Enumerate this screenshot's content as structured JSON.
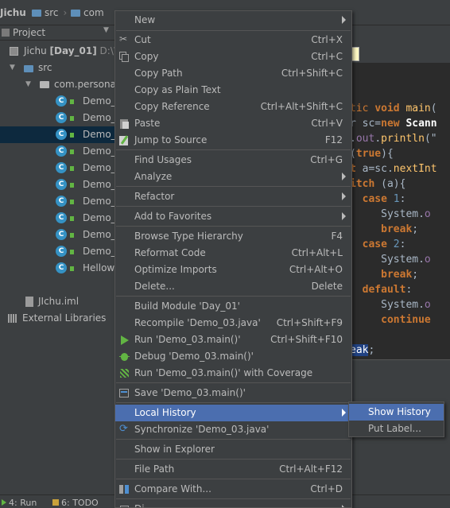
{
  "navbar": {
    "project": "Jichu",
    "src": "src",
    "com": "com"
  },
  "project_panel": {
    "title": "Project",
    "root_label": "Jichu",
    "root_module": "[Day_01]",
    "root_path": "D:\\W",
    "src": "src",
    "package": "com.persona",
    "files": [
      "Demo_",
      "Demo_",
      "Demo_",
      "Demo_",
      "Demo_",
      "Demo_",
      "Demo_",
      "Demo_",
      "Demo_",
      "Demo_",
      "Hellow"
    ],
    "selected_index": 2,
    "iml": "JIchu.iml",
    "ext_libs": "External Libraries"
  },
  "editor": {
    "lines": [
      {
        "segs": [
          [
            "kw2",
            "tic "
          ],
          [
            "kw",
            "void "
          ],
          [
            "fn",
            "main"
          ],
          [
            "plain",
            "("
          ]
        ]
      },
      {
        "segs": [
          [
            "plain",
            "r sc="
          ],
          [
            "kw",
            "new "
          ],
          [
            "wht",
            "Scann"
          ]
        ]
      },
      {
        "segs": [
          [
            "plain",
            "."
          ],
          [
            "fld",
            "out"
          ],
          [
            "plain",
            "."
          ],
          [
            "fn",
            "println"
          ],
          [
            "plain",
            "(\""
          ]
        ]
      },
      {
        "segs": [
          [
            "plain",
            "("
          ],
          [
            "kw",
            "true"
          ],
          [
            "plain",
            "){"
          ]
        ]
      },
      {
        "segs": [
          [
            "kw",
            "t "
          ],
          [
            "plain",
            "a=sc."
          ],
          [
            "fn",
            "nextInt"
          ]
        ]
      },
      {
        "segs": [
          [
            "kw",
            "itch "
          ],
          [
            "plain",
            "(a){"
          ]
        ]
      },
      {
        "segs": [
          [
            "plain",
            "  "
          ],
          [
            "kw",
            "case "
          ],
          [
            "num",
            "1"
          ],
          [
            "plain",
            ":"
          ]
        ]
      },
      {
        "segs": [
          [
            "plain",
            "     System."
          ],
          [
            "fld",
            "o"
          ]
        ]
      },
      {
        "segs": [
          [
            "plain",
            "     "
          ],
          [
            "kw",
            "break"
          ],
          [
            "plain",
            ";"
          ]
        ]
      },
      {
        "segs": [
          [
            "plain",
            "  "
          ],
          [
            "kw",
            "case "
          ],
          [
            "num",
            "2"
          ],
          [
            "plain",
            ":"
          ]
        ]
      },
      {
        "segs": [
          [
            "plain",
            "     System."
          ],
          [
            "fld",
            "o"
          ]
        ]
      },
      {
        "segs": [
          [
            "plain",
            "     "
          ],
          [
            "kw",
            "break"
          ],
          [
            "plain",
            ";"
          ]
        ]
      },
      {
        "segs": [
          [
            "plain",
            "  "
          ],
          [
            "kw",
            "default"
          ],
          [
            "plain",
            ":"
          ]
        ]
      },
      {
        "segs": [
          [
            "plain",
            "     System."
          ],
          [
            "fld",
            "o"
          ]
        ]
      },
      {
        "segs": [
          [
            "plain",
            "     "
          ],
          [
            "kw",
            "continue"
          ]
        ]
      },
      {
        "segs": [
          [
            "plain",
            ""
          ]
        ]
      },
      {
        "segs": [
          [
            "kwh",
            "eak"
          ],
          [
            "plain",
            ";"
          ]
        ]
      }
    ]
  },
  "context_menu": {
    "new": "New",
    "cut": "Cut",
    "cut_sc": "Ctrl+X",
    "copy": "Copy",
    "copy_sc": "Ctrl+C",
    "copy_path": "Copy Path",
    "copy_path_sc": "Ctrl+Shift+C",
    "copy_plain": "Copy as Plain Text",
    "copy_ref": "Copy Reference",
    "copy_ref_sc": "Ctrl+Alt+Shift+C",
    "paste": "Paste",
    "paste_sc": "Ctrl+V",
    "jump": "Jump to Source",
    "jump_sc": "F12",
    "find_usages": "Find Usages",
    "find_usages_sc": "Ctrl+G",
    "analyze": "Analyze",
    "refactor": "Refactor",
    "add_fav": "Add to Favorites",
    "browse_type": "Browse Type Hierarchy",
    "browse_type_sc": "F4",
    "reformat": "Reformat Code",
    "reformat_sc": "Ctrl+Alt+L",
    "optimize": "Optimize Imports",
    "optimize_sc": "Ctrl+Alt+O",
    "delete": "Delete...",
    "delete_sc": "Delete",
    "build_module": "Build Module 'Day_01'",
    "recompile": "Recompile 'Demo_03.java'",
    "recompile_sc": "Ctrl+Shift+F9",
    "run": "Run 'Demo_03.main()'",
    "run_sc": "Ctrl+Shift+F10",
    "debug": "Debug 'Demo_03.main()'",
    "run_cov": "Run 'Demo_03.main()' with Coverage",
    "save": "Save 'Demo_03.main()'",
    "local_history": "Local History",
    "synchronize": "Synchronize 'Demo_03.java'",
    "show_explorer": "Show in Explorer",
    "file_path": "File Path",
    "file_path_sc": "Ctrl+Alt+F12",
    "compare": "Compare With...",
    "compare_sc": "Ctrl+D",
    "diagrams": "Di"
  },
  "submenu": {
    "show_history": "Show History",
    "put_label": "Put Label..."
  },
  "status_bar": {
    "run": "4: Run",
    "todo": "6: TODO"
  }
}
